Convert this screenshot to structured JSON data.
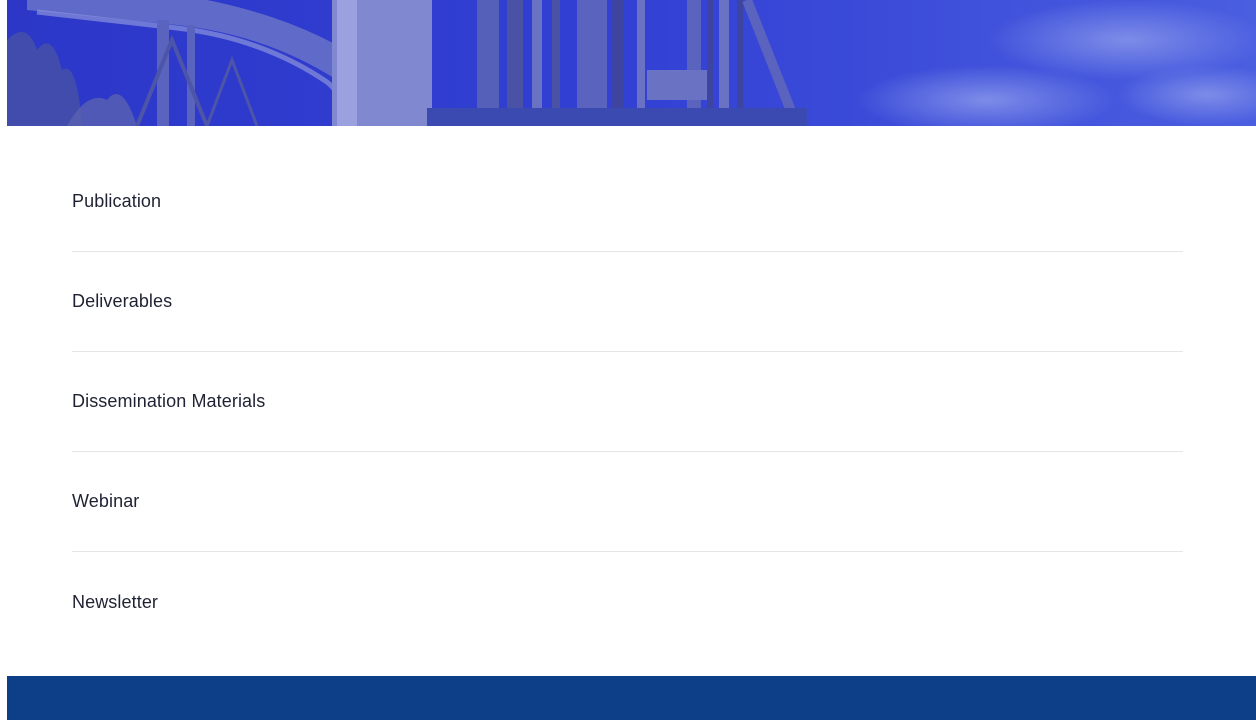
{
  "hero": {
    "image": "industrial-plant-banner",
    "tint_color": "#3340d6"
  },
  "menu": {
    "items": [
      {
        "label": "Publication"
      },
      {
        "label": "Deliverables"
      },
      {
        "label": "Dissemination Materials"
      },
      {
        "label": "Webinar"
      },
      {
        "label": "Newsletter"
      }
    ]
  },
  "colors": {
    "text": "#1f2233",
    "divider": "#e6e6ea",
    "footer": "#0c3f87"
  }
}
